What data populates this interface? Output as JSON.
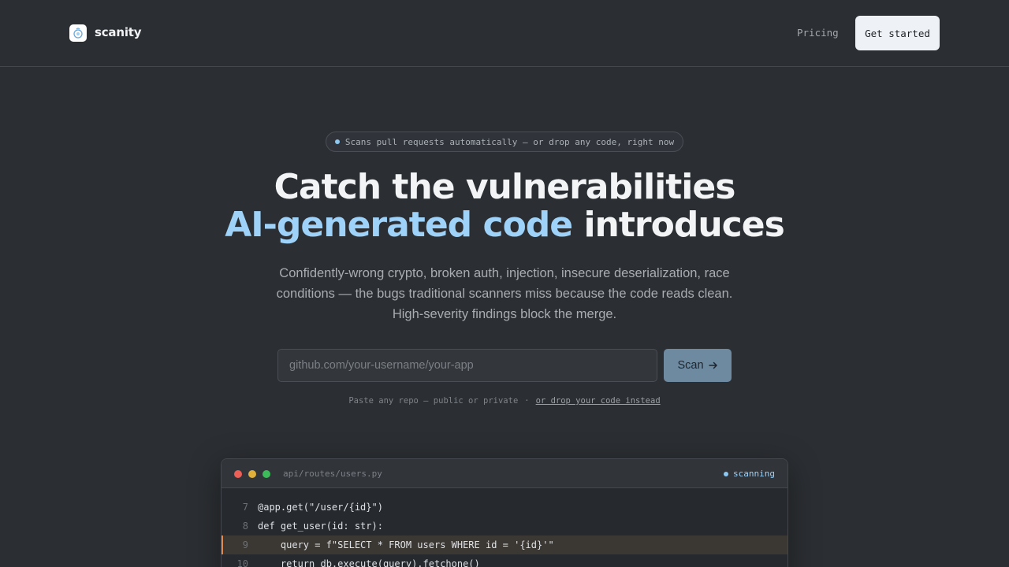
{
  "header": {
    "brand": "scanity",
    "logo_icon": "scanity-logo-icon",
    "nav_pricing": "Pricing",
    "cta": "Get started"
  },
  "hero": {
    "pill_text": "Scans pull requests automatically — or drop any code, right now",
    "headline_line1": "Catch the vulnerabilities",
    "headline_accent": "AI-generated code",
    "headline_rest": " introduces",
    "subtext": "Confidently-wrong crypto, broken auth, injection, insecure deserialization, race conditions — the bugs traditional scanners miss because the code reads clean. High-severity findings block the merge.",
    "input_placeholder": "github.com/your-username/your-app",
    "input_value": "",
    "scan_label": "Scan",
    "scan_icon": "arrow-right-icon",
    "hint_text": "Paste any repo — public or private",
    "hint_separator": "·",
    "hint_link": "or drop your code instead"
  },
  "editor": {
    "filename": "api/routes/users.py",
    "status": "scanning",
    "lines": [
      {
        "n": "7",
        "code": "@app.get(\"/user/{id}\")"
      },
      {
        "n": "8",
        "code": "def get_user(id: str):"
      },
      {
        "n": "9",
        "code": "    query = f\"SELECT * FROM users WHERE id = '{id}'\""
      },
      {
        "n": "10",
        "code": "    return db.execute(query).fetchone()"
      }
    ]
  },
  "colors": {
    "background": "#2b2e32",
    "accent": "#9fd2f8",
    "highlight_marker": "#e08a50"
  }
}
